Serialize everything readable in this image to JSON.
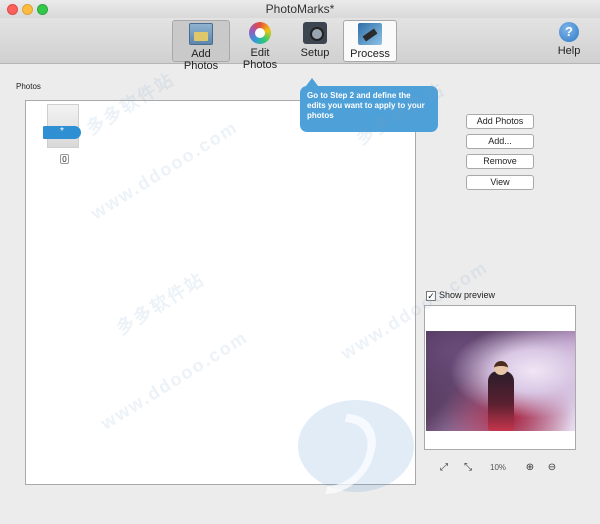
{
  "window": {
    "title": "PhotoMarks*"
  },
  "toolbar": {
    "add_photos": "Add Photos",
    "edit_photos": "Edit Photos",
    "setup": "Setup",
    "process": "Process",
    "help": "Help",
    "help_glyph": "?"
  },
  "tooltip": {
    "text": "Go to Step 2 and define the edits you want to apply to your photos"
  },
  "photos": {
    "label": "Photos",
    "thumb_glyph": "*",
    "count": "0"
  },
  "side_buttons": {
    "add_photos": "Add Photos",
    "add": "Add...",
    "remove": "Remove",
    "view": "View"
  },
  "preview": {
    "show_label": "Show preview",
    "checked_glyph": "✓",
    "zoom_level": "10%"
  },
  "watermarks": [
    "www.ddooo.com",
    "多多软件站"
  ],
  "colors": {
    "accent": "#4ea0d8",
    "window_bg": "#ececec"
  }
}
